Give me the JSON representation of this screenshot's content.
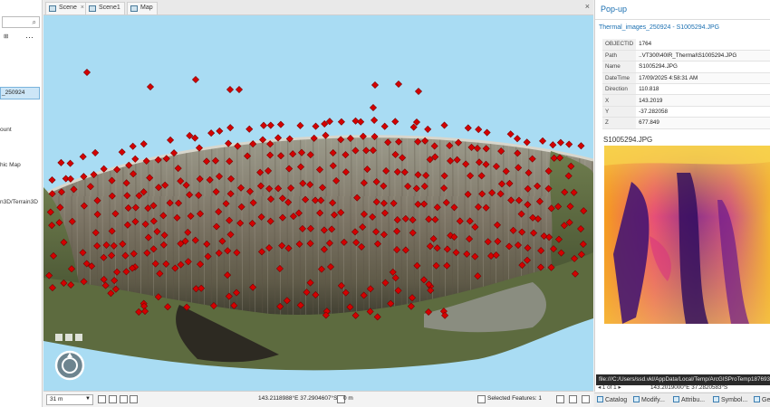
{
  "left_pane": {
    "search_icon": "search-icon",
    "selected_layer": "_250924",
    "items": [
      "ount",
      "hic Map",
      "n3D/Terrain3D"
    ]
  },
  "tabs": [
    {
      "label": "Scene",
      "active": true
    },
    {
      "label": "Scene1",
      "active": false
    },
    {
      "label": "Map",
      "active": false
    }
  ],
  "statusbar": {
    "scale": "31 m",
    "coordinates": "143.2118988°E 37.2904607°S",
    "elevation": "0 m",
    "selected_features": "Selected Features: 1"
  },
  "popup": {
    "title": "Pop-up",
    "feature_title": "Thermal_images_250924 - S1005294.JPG",
    "attributes": [
      {
        "key": "OBJECTID",
        "value": "1764"
      },
      {
        "key": "Path",
        "value": "..VT300\\40IR_Thermal\\S1005294.JPG"
      },
      {
        "key": "Name",
        "value": "S1005294.JPG"
      },
      {
        "key": "DateTime",
        "value": "17/09/2025 4:58:31 AM"
      },
      {
        "key": "Direction",
        "value": "110.818"
      },
      {
        "key": "X",
        "value": "143.2019"
      },
      {
        "key": "Y",
        "value": "-37.282058"
      },
      {
        "key": "Z",
        "value": "677.849"
      }
    ],
    "image_caption": "S1005294.JPG",
    "file_url": "file:///C:/Users/ssd.vkl/AppData/Local/Temp/ArcGISProTemp1876936",
    "nav_text": "1 of 1",
    "nav_coords": "143.2019000°E 37.2820583°S"
  },
  "dock_tabs": [
    "Catalog",
    "Modify...",
    "Attribu...",
    "Symbol...",
    "Ge"
  ],
  "colors": {
    "accent": "#1a6fb1",
    "marker": "#d40000",
    "water": "#a9dcf3"
  }
}
